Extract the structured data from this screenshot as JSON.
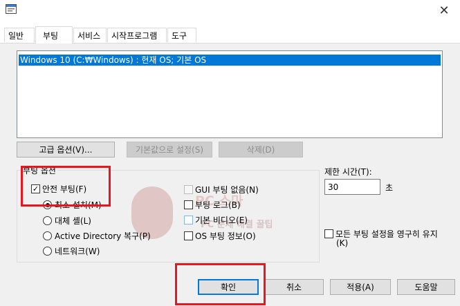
{
  "window": {
    "icon": "msconfig-icon",
    "close_label": "✕"
  },
  "tabs": [
    {
      "label": "일반",
      "active": false
    },
    {
      "label": "부팅",
      "active": true
    },
    {
      "label": "서비스",
      "active": false
    },
    {
      "label": "시작프로그램",
      "active": false
    },
    {
      "label": "도구",
      "active": false
    }
  ],
  "os_list": {
    "items": [
      "Windows 10 (C:₩Windows) : 현재 OS; 기본 OS"
    ],
    "selected_index": 0
  },
  "os_buttons": {
    "advanced_label": "고급 옵션(V)...",
    "set_default_label": "기본값으로 설정(S)",
    "delete_label": "삭제(D)"
  },
  "boot_options": {
    "title": "부팅 옵션",
    "safe_boot": {
      "label": "안전 부팅(F)",
      "checked": true
    },
    "radios": [
      {
        "label": "최소 설치(M)",
        "selected": true
      },
      {
        "label": "대체 셸(L)",
        "selected": false
      },
      {
        "label": "Active Directory 복구(P)",
        "selected": false
      },
      {
        "label": "네트워크(W)",
        "selected": false
      }
    ],
    "checkboxes": [
      {
        "label": "GUI 부팅 없음(N)",
        "checked": false
      },
      {
        "label": "부팅 로그(B)",
        "checked": false
      },
      {
        "label": "기본 비디오(E)",
        "checked": false
      },
      {
        "label": "OS 부팅 정보(O)",
        "checked": false
      }
    ]
  },
  "timeout": {
    "label": "제한 시간(T):",
    "value": "30",
    "unit": "초"
  },
  "permanent": {
    "label_line1": "모든 부팅 설정을 영구히 유지",
    "label_line2": "(K)",
    "checked": false
  },
  "footer": {
    "ok_label": "확인",
    "cancel_label": "취소",
    "apply_label": "적용(A)",
    "help_label": "도움말"
  },
  "watermark": {
    "line1": "PC 스마",
    "line2": "PC 문제 해결 꿀팁"
  },
  "colors": {
    "selection": "#0078d7",
    "highlight_box": "#e8161c",
    "panel": "#f0f0f0"
  }
}
